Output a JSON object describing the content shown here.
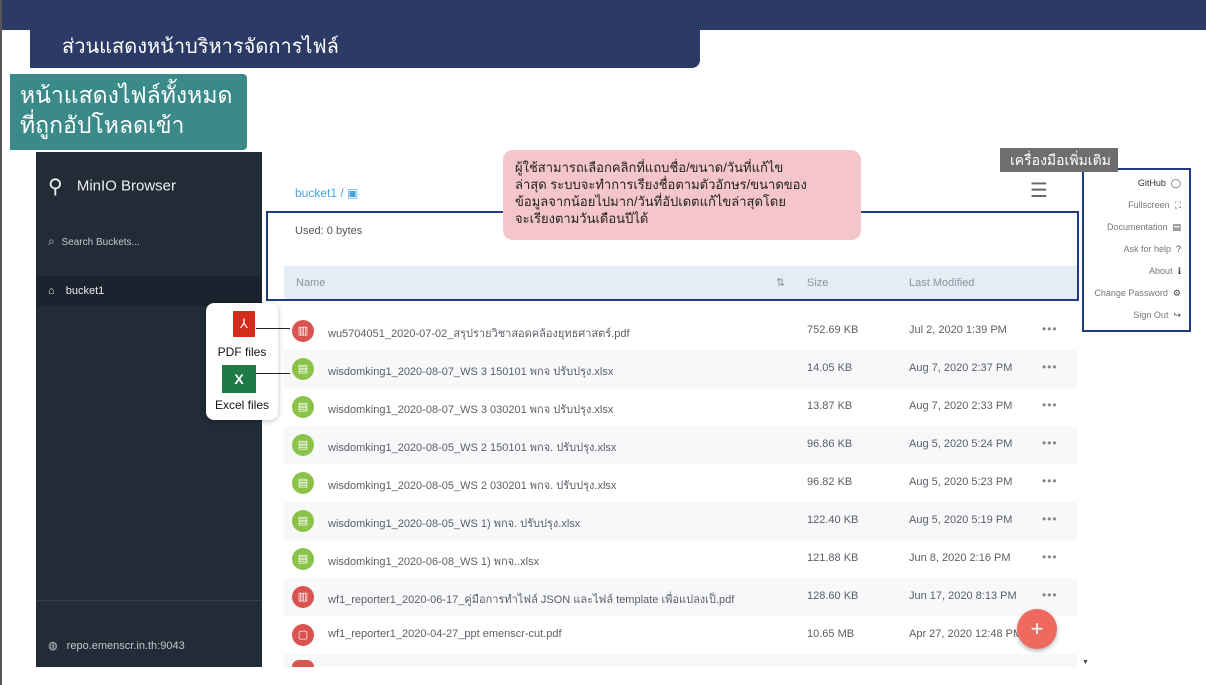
{
  "slide": {
    "title": "ส่วนแสดงหน้าบริหารจัดการไฟล์",
    "side_label_line1": "หน้าแสดงไฟล์ทั้งหมด",
    "side_label_line2": "ที่ถูกอัปโหลดเข้าระบบ",
    "tooltip_lines": [
      "ผู้ใช้สามารถเลือกคลิกที่แถบชื่อ/ขนาด/วันที่แก้ไข",
      "ล่าสุด ระบบจะทำการเรียงชื่อตามตัวอักษร/ขนาดของ",
      "ข้อมูลจากน้อยไปมาก/วันที่อัปเดตแก้ไขล่าสุดโดย",
      "จะเรียงตามวันเดือนปีได้"
    ],
    "tools_label": "เครื่องมือเพิ่มเติม",
    "pdf_caption": "PDF files",
    "excel_caption": "Excel files"
  },
  "sidebar": {
    "app_name": "MinIO Browser",
    "search_placeholder": "Search Buckets...",
    "buckets": [
      "bucket1"
    ],
    "host": "repo.emenscr.in.th:9043"
  },
  "main": {
    "breadcrumb": "bucket1 /",
    "used": "Used: 0 bytes",
    "columns": {
      "name": "Name",
      "size": "Size",
      "modified": "Last Modified"
    },
    "files": [
      {
        "type": "pdf",
        "name": "wu5704051_2020-07-02_สรุปรายวิชาสอดคล้องยุทธศาสตร์.pdf",
        "size": "752.69 KB",
        "modified": "Jul 2, 2020 1:39 PM"
      },
      {
        "type": "xls",
        "name": "wisdomking1_2020-08-07_WS 3 150101 พกจ ปรับปรุง.xlsx",
        "size": "14.05 KB",
        "modified": "Aug 7, 2020 2:37 PM"
      },
      {
        "type": "xls",
        "name": "wisdomking1_2020-08-07_WS 3 030201 พกจ ปรับปรุง.xlsx",
        "size": "13.87 KB",
        "modified": "Aug 7, 2020 2:33 PM"
      },
      {
        "type": "xls",
        "name": "wisdomking1_2020-08-05_WS 2 150101 พกจ. ปรับปรุง.xlsx",
        "size": "96.86 KB",
        "modified": "Aug 5, 2020 5:24 PM"
      },
      {
        "type": "xls",
        "name": "wisdomking1_2020-08-05_WS 2 030201 พกจ. ปรับปรุง.xlsx",
        "size": "96.82 KB",
        "modified": "Aug 5, 2020 5:23 PM"
      },
      {
        "type": "xls",
        "name": "wisdomking1_2020-08-05_WS 1) พกจ. ปรับปรุง.xlsx",
        "size": "122.40 KB",
        "modified": "Aug 5, 2020 5:19 PM"
      },
      {
        "type": "xls",
        "name": "wisdomking1_2020-06-08_WS 1) พกจ..xlsx",
        "size": "121.88 KB",
        "modified": "Jun 8, 2020 2:16 PM"
      },
      {
        "type": "pdf",
        "name": "wf1_reporter1_2020-06-17_คู่มือการทำไฟล์ JSON และไฟล์ template เพื่อแปลงเป็.pdf",
        "size": "128.60 KB",
        "modified": "Jun 17, 2020 8:13 PM"
      },
      {
        "type": "pdf",
        "name": "wf1_reporter1_2020-04-27_ppt emenscr-cut.pdf",
        "size": "10.65 MB",
        "modified": "Apr 27, 2020 12:48 PM"
      }
    ],
    "row_menu": "•••",
    "fab": "+"
  },
  "menu": [
    "GitHub",
    "Fullscreen",
    "Documentation",
    "Ask for help",
    "About",
    "Change Password",
    "Sign Out"
  ],
  "icons": {
    "menu": [
      "github-icon",
      "fullscreen-icon",
      "documentation-icon",
      "help-icon",
      "info-icon",
      "gear-icon",
      "sign-out-icon"
    ],
    "menu_glyphs": [
      "◯",
      "⛶",
      "▤",
      "?",
      "ℹ",
      "⚙",
      "↪"
    ]
  },
  "colors": {
    "header": "#2c3a66",
    "sidebar": "#222c37",
    "accent": "#47a4e0",
    "fab": "#ef6a5e",
    "pdf": "#d9534f",
    "xls": "#8bc34a",
    "highlight": "#223a80"
  }
}
